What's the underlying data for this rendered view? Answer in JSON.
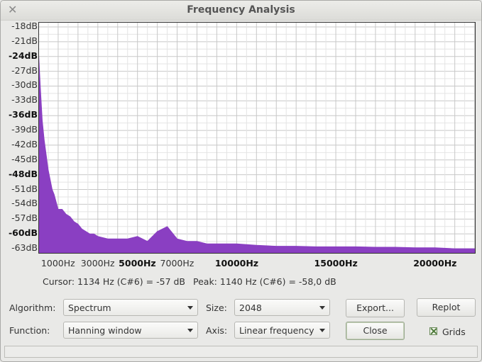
{
  "window": {
    "title": "Frequency Analysis"
  },
  "chart_data": {
    "type": "area",
    "y_ticks": [
      "-18dB",
      "-21dB",
      "-24dB",
      "-27dB",
      "-30dB",
      "-33dB",
      "-36dB",
      "-39dB",
      "-42dB",
      "-45dB",
      "-48dB",
      "-51dB",
      "-54dB",
      "-57dB",
      "-60dB",
      "-63dB"
    ],
    "ylim": [
      -64,
      -17
    ],
    "x_ticks": [
      "1000Hz",
      "3000Hz",
      "5000Hz",
      "7000Hz",
      "10000Hz",
      "15000Hz",
      "20000Hz"
    ],
    "xlim": [
      0,
      22050
    ],
    "x_hz": [
      0,
      100,
      200,
      300,
      400,
      500,
      600,
      700,
      800,
      900,
      1000,
      1200,
      1400,
      1600,
      1800,
      2000,
      2200,
      2400,
      2600,
      2800,
      3000,
      3500,
      4000,
      4500,
      5000,
      5500,
      6000,
      6500,
      7000,
      7500,
      8000,
      8500,
      9000,
      10000,
      11000,
      12000,
      13000,
      14000,
      15000,
      16000,
      17000,
      18000,
      19000,
      20000,
      21000,
      22050
    ],
    "y_db": [
      -22,
      -30,
      -37,
      -41,
      -44,
      -47,
      -49,
      -51,
      -52,
      -53.5,
      -55,
      -55,
      -56,
      -56.5,
      -57.5,
      -58,
      -59,
      -59.5,
      -60,
      -60,
      -60.5,
      -61,
      -61,
      -61,
      -60.5,
      -61.5,
      -59.5,
      -58.5,
      -61,
      -61.5,
      -61.5,
      -62,
      -62,
      -62,
      -62.3,
      -62.5,
      -62.5,
      -62.6,
      -62.6,
      -62.6,
      -62.7,
      -62.7,
      -62.8,
      -62.8,
      -63,
      -63
    ],
    "series_color": "#8a3fc2",
    "grid": true
  },
  "readout": {
    "cursor": "Cursor: 1134 Hz (C#6) = -57 dB",
    "peak": "Peak: 1140 Hz (C#6) = -58,0 dB"
  },
  "controls": {
    "algorithm_label": "Algorithm:",
    "algorithm_value": "Spectrum",
    "function_label": "Function:",
    "function_value": "Hanning window",
    "size_label": "Size:",
    "size_value": "2048",
    "axis_label": "Axis:",
    "axis_value": "Linear frequency",
    "export_label": "Export...",
    "replot_label": "Replot",
    "close_label": "Close",
    "grids_label": "Grids",
    "grids_checked": true
  }
}
